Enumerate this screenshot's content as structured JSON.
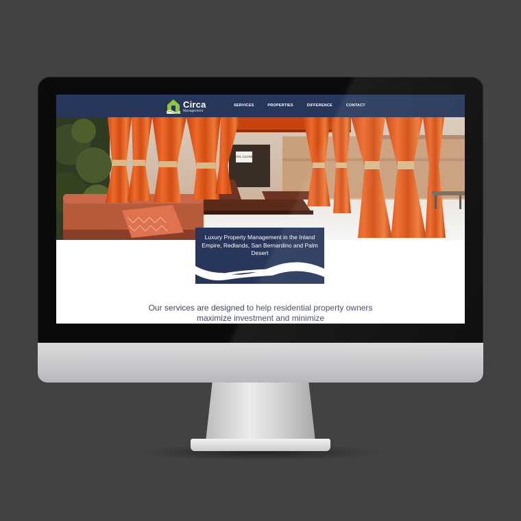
{
  "site": {
    "logo": {
      "name": "Circa",
      "subtitle": "Management"
    },
    "nav": {
      "items": [
        {
          "label": "SERVICES"
        },
        {
          "label": "PROPERTIES"
        },
        {
          "label": "DIFFERENCE"
        },
        {
          "label": "CONTACT"
        }
      ]
    },
    "hero": {
      "sign_text": "POOL CLOSED"
    },
    "callout": {
      "text": "Luxury Property Management in the Inland Empire, Redlands, San Bernardino and Palm Desert"
    },
    "intro": {
      "text": "Our services are designed to help residential property owners maximize investment and minimize"
    }
  },
  "colors": {
    "header_bg": "#27365a",
    "callout_bg": "#27365a",
    "accent_green": "#8dc63f",
    "curtain_orange": "#e2571c",
    "background": "#424242"
  },
  "icons": {
    "logo": "house-logo-icon"
  }
}
